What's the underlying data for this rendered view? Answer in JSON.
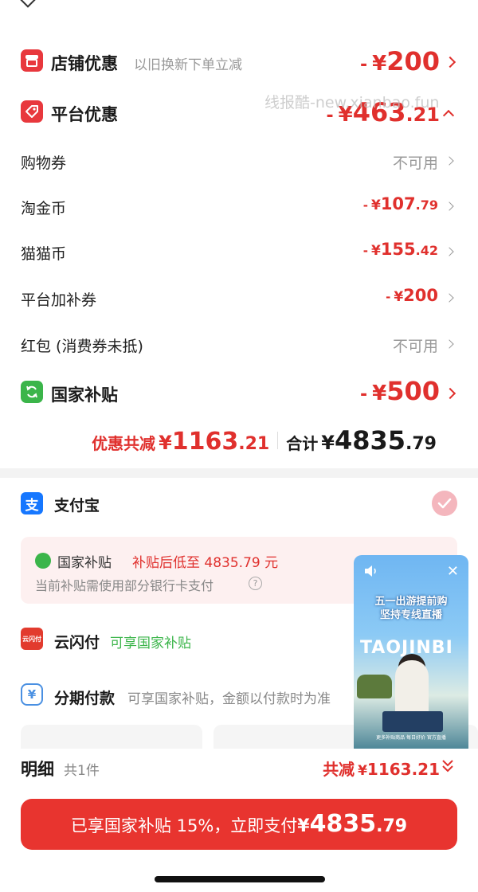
{
  "colors": {
    "accent_red": "#e0302d",
    "green": "#3bb54a",
    "alipay_blue": "#1677ff"
  },
  "store_discount": {
    "icon": "store-icon",
    "title": "店铺优惠",
    "subtitle": "以旧换新下单立减",
    "sign": "-",
    "currency": "¥",
    "amount": "200"
  },
  "platform_discount": {
    "icon": "tag-icon",
    "title": "平台优惠",
    "sign": "-",
    "currency": "¥",
    "amount_int": "463",
    "amount_dec": ".21"
  },
  "watermark": "线报酷-new.xianbao.fun",
  "discount_items": [
    {
      "label": "购物券",
      "value": "不可用"
    },
    {
      "label": "淘金币",
      "sign": "-",
      "currency": "¥",
      "int": "107",
      "dec": ".79"
    },
    {
      "label": "猫猫币",
      "sign": "-",
      "currency": "¥",
      "int": "155",
      "dec": ".42"
    },
    {
      "label": "平台加补券",
      "sign": "-",
      "currency": "¥",
      "int": "200",
      "dec": ""
    },
    {
      "label": "红包 (消费券未抵)",
      "value": "不可用"
    }
  ],
  "national_subsidy": {
    "icon": "refresh-icon",
    "title": "国家补贴",
    "sign": "-",
    "currency": "¥",
    "amount": "500"
  },
  "summary": {
    "discount_label": "优惠共减",
    "discount_currency": "¥",
    "discount_int": "1163",
    "discount_dec": ".21",
    "total_label": "合计",
    "total_currency": "¥",
    "total_int": "4835",
    "total_dec": ".79"
  },
  "payment_methods": {
    "alipay": {
      "icon": "alipay-icon",
      "glyph": "支",
      "name": "支付宝",
      "selected": true
    },
    "subsidy_box": {
      "title": "国家补贴",
      "highlight": "补贴后低至 4835.79 元",
      "note": "当前补贴需使用部分银行卡支付",
      "help_glyph": "?"
    },
    "unionpay": {
      "icon": "unionpay-icon",
      "glyph": "云闪付",
      "name": "云闪付",
      "note": "可享国家补贴"
    },
    "installment": {
      "icon": "yen-circle-icon",
      "glyph": "¥",
      "name": "分期付款",
      "note": "可享国家补贴，金额以付款时为准"
    }
  },
  "live_video": {
    "headline_1": "五一出游提前购",
    "headline_2": "坚持专线直播",
    "big_text": "TAOJINBI",
    "footer": "更多补贴商品 每日好价 官方直播"
  },
  "detail": {
    "title": "明细",
    "count": "共1件",
    "total_label": "共减",
    "total_currency": "¥",
    "total_amount": "1163.21"
  },
  "pay_button": {
    "label": "已享国家补贴 15%，立即支付",
    "currency": "¥",
    "amount_int": "4835",
    "amount_dec": ".79"
  }
}
